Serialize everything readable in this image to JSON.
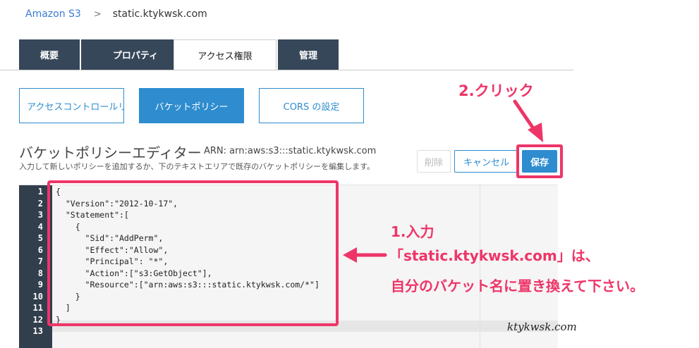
{
  "breadcrumb": {
    "root": "Amazon S3",
    "separator": ">",
    "current": "static.ktykwsk.com"
  },
  "tabs": [
    {
      "label": "概要",
      "active": false
    },
    {
      "label": "プロパティ",
      "active": false
    },
    {
      "label": "アクセス権限",
      "active": true
    },
    {
      "label": "管理",
      "active": false
    }
  ],
  "subtabs": [
    {
      "label": "アクセスコントロールリスト",
      "active": false
    },
    {
      "label": "バケットポリシー",
      "active": true
    },
    {
      "label": "CORS の設定",
      "active": false
    }
  ],
  "editor": {
    "title": "バケットポリシーエディター",
    "arn": "ARN: arn:aws:s3:::static.ktykwsk.com",
    "description": "入力して新しいポリシーを追加するか、下のテキストエリアで既存のバケットポリシーを編集します。",
    "buttons": {
      "delete": "削除",
      "cancel": "キャンセル",
      "save": "保存"
    },
    "line_numbers": [
      "1",
      "2",
      "3",
      "4",
      "5",
      "6",
      "7",
      "8",
      "9",
      "10",
      "11",
      "12",
      "13"
    ],
    "code_lines": [
      "{",
      "  \"Version\":\"2012-10-17\",",
      "  \"Statement\":[",
      "    {",
      "      \"Sid\":\"AddPerm\",",
      "      \"Effect\":\"Allow\",",
      "      \"Principal\": \"*\",",
      "      \"Action\":[\"s3:GetObject\"],",
      "      \"Resource\":[\"arn:aws:s3:::static.ktykwsk.com/*\"]",
      "    }",
      "  ]",
      "}",
      ""
    ]
  },
  "annotations": {
    "click": "2.クリック",
    "input": "1.入力",
    "note_line1": "「static.ktykwsk.com」は、",
    "note_line2": "自分のバケット名に置き換えて下さい。",
    "color": "#ee3568"
  },
  "watermark": "ktykwsk.com",
  "colors": {
    "accent": "#2e8ccf",
    "tab_dark": "#37475a",
    "gutter": "#313e4c",
    "highlight": "#ee3568"
  }
}
